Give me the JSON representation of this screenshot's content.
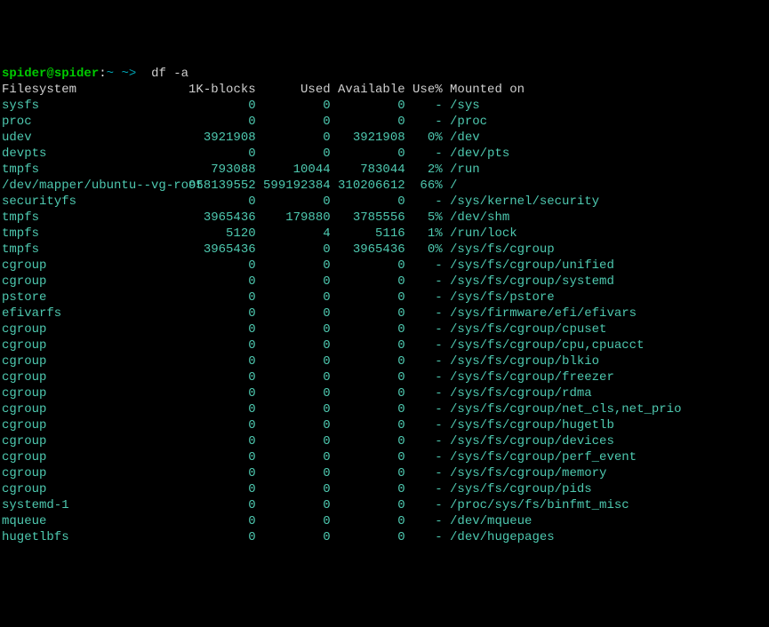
{
  "prompt": {
    "user": "spider",
    "at": "@",
    "host": "spider",
    "sep": ":",
    "tilde": "~ ~>",
    "command": "  df -a"
  },
  "header": {
    "fs": "Filesystem",
    "blocks": "1K-blocks",
    "used": "Used",
    "avail": "Available",
    "usep": "Use%",
    "mount": "Mounted on"
  },
  "rows": [
    {
      "fs": "sysfs",
      "blocks": "0",
      "used": "0",
      "avail": "0",
      "usep": "-",
      "mount": "/sys"
    },
    {
      "fs": "proc",
      "blocks": "0",
      "used": "0",
      "avail": "0",
      "usep": "-",
      "mount": "/proc"
    },
    {
      "fs": "udev",
      "blocks": "3921908",
      "used": "0",
      "avail": "3921908",
      "usep": "0%",
      "mount": "/dev"
    },
    {
      "fs": "devpts",
      "blocks": "0",
      "used": "0",
      "avail": "0",
      "usep": "-",
      "mount": "/dev/pts"
    },
    {
      "fs": "tmpfs",
      "blocks": "793088",
      "used": "10044",
      "avail": "783044",
      "usep": "2%",
      "mount": "/run"
    },
    {
      "fs": "/dev/mapper/ubuntu--vg-root",
      "blocks": "958139552",
      "used": "599192384",
      "avail": "310206612",
      "usep": "66%",
      "mount": "/"
    },
    {
      "fs": "securityfs",
      "blocks": "0",
      "used": "0",
      "avail": "0",
      "usep": "-",
      "mount": "/sys/kernel/security"
    },
    {
      "fs": "tmpfs",
      "blocks": "3965436",
      "used": "179880",
      "avail": "3785556",
      "usep": "5%",
      "mount": "/dev/shm"
    },
    {
      "fs": "tmpfs",
      "blocks": "5120",
      "used": "4",
      "avail": "5116",
      "usep": "1%",
      "mount": "/run/lock"
    },
    {
      "fs": "tmpfs",
      "blocks": "3965436",
      "used": "0",
      "avail": "3965436",
      "usep": "0%",
      "mount": "/sys/fs/cgroup"
    },
    {
      "fs": "cgroup",
      "blocks": "0",
      "used": "0",
      "avail": "0",
      "usep": "-",
      "mount": "/sys/fs/cgroup/unified"
    },
    {
      "fs": "cgroup",
      "blocks": "0",
      "used": "0",
      "avail": "0",
      "usep": "-",
      "mount": "/sys/fs/cgroup/systemd"
    },
    {
      "fs": "pstore",
      "blocks": "0",
      "used": "0",
      "avail": "0",
      "usep": "-",
      "mount": "/sys/fs/pstore"
    },
    {
      "fs": "efivarfs",
      "blocks": "0",
      "used": "0",
      "avail": "0",
      "usep": "-",
      "mount": "/sys/firmware/efi/efivars"
    },
    {
      "fs": "cgroup",
      "blocks": "0",
      "used": "0",
      "avail": "0",
      "usep": "-",
      "mount": "/sys/fs/cgroup/cpuset"
    },
    {
      "fs": "cgroup",
      "blocks": "0",
      "used": "0",
      "avail": "0",
      "usep": "-",
      "mount": "/sys/fs/cgroup/cpu,cpuacct"
    },
    {
      "fs": "cgroup",
      "blocks": "0",
      "used": "0",
      "avail": "0",
      "usep": "-",
      "mount": "/sys/fs/cgroup/blkio"
    },
    {
      "fs": "cgroup",
      "blocks": "0",
      "used": "0",
      "avail": "0",
      "usep": "-",
      "mount": "/sys/fs/cgroup/freezer"
    },
    {
      "fs": "cgroup",
      "blocks": "0",
      "used": "0",
      "avail": "0",
      "usep": "-",
      "mount": "/sys/fs/cgroup/rdma"
    },
    {
      "fs": "cgroup",
      "blocks": "0",
      "used": "0",
      "avail": "0",
      "usep": "-",
      "mount": "/sys/fs/cgroup/net_cls,net_prio"
    },
    {
      "fs": "cgroup",
      "blocks": "0",
      "used": "0",
      "avail": "0",
      "usep": "-",
      "mount": "/sys/fs/cgroup/hugetlb"
    },
    {
      "fs": "cgroup",
      "blocks": "0",
      "used": "0",
      "avail": "0",
      "usep": "-",
      "mount": "/sys/fs/cgroup/devices"
    },
    {
      "fs": "cgroup",
      "blocks": "0",
      "used": "0",
      "avail": "0",
      "usep": "-",
      "mount": "/sys/fs/cgroup/perf_event"
    },
    {
      "fs": "cgroup",
      "blocks": "0",
      "used": "0",
      "avail": "0",
      "usep": "-",
      "mount": "/sys/fs/cgroup/memory"
    },
    {
      "fs": "cgroup",
      "blocks": "0",
      "used": "0",
      "avail": "0",
      "usep": "-",
      "mount": "/sys/fs/cgroup/pids"
    },
    {
      "fs": "systemd-1",
      "blocks": "0",
      "used": "0",
      "avail": "0",
      "usep": "-",
      "mount": "/proc/sys/fs/binfmt_misc"
    },
    {
      "fs": "mqueue",
      "blocks": "0",
      "used": "0",
      "avail": "0",
      "usep": "-",
      "mount": "/dev/mqueue"
    },
    {
      "fs": "hugetlbfs",
      "blocks": "0",
      "used": "0",
      "avail": "0",
      "usep": "-",
      "mount": "/dev/hugepages"
    }
  ]
}
